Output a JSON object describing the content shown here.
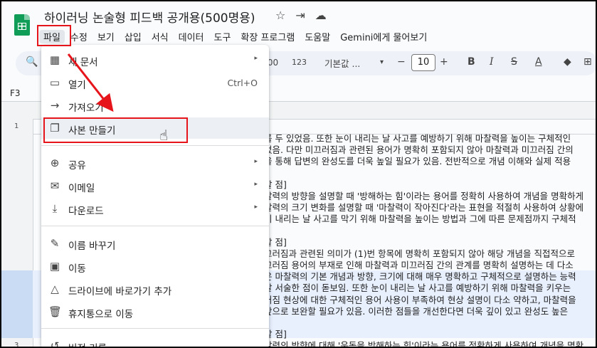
{
  "doc": {
    "title": "하이러닝 논술형 피드백 공개용(500명용)"
  },
  "header_icons": [
    "star-icon",
    "move-folder-icon",
    "cloud-status-icon"
  ],
  "menubar": [
    "파일",
    "수정",
    "보기",
    "삽입",
    "서식",
    "데이터",
    "도구",
    "확장 프로그램",
    "도움말",
    "Gemini에게 물어보기"
  ],
  "toolbar": {
    "number_format": "123",
    "font": "기본값 ...",
    "font_size": "10"
  },
  "name_box": "F3",
  "row_numbers": [
    "1",
    "3"
  ],
  "file_menu": {
    "items": [
      {
        "icon": "new-document-icon",
        "label": "새 문서",
        "arrow": "▸"
      },
      {
        "icon": "open-folder-icon",
        "label": "열기",
        "shortcut": "Ctrl+O"
      },
      {
        "icon": "import-icon",
        "label": "가져오기"
      },
      {
        "icon": "copy-icon",
        "label": "사본 만들기"
      },
      {
        "icon": "share-icon",
        "label": "공유",
        "arrow": "▸"
      },
      {
        "icon": "email-icon",
        "label": "이메일",
        "arrow": "▸"
      },
      {
        "icon": "download-icon",
        "label": "다운로드",
        "arrow": "▸"
      },
      {
        "icon": "rename-icon",
        "label": "이름 바꾸기"
      },
      {
        "icon": "move-icon",
        "label": "이동"
      },
      {
        "icon": "drive-shortcut-icon",
        "label": "드라이브에 바로가기 추가"
      },
      {
        "icon": "trash-icon",
        "label": "휴지통으로 이동"
      },
      {
        "icon": "version-history-icon",
        "label": "버전 기록"
      }
    ]
  },
  "sheet_lines": [
    "를 두 있었음. 또한 눈이 내리는 날 사고를 예방하기 위해 마찰력을 높이는 구체적인",
    "었음. 다만 미끄러짐과 관련된 용어가 명확히 포함되지 않아 마찰력과 미끄러짐 간의",
    "을 통해 답변의 완성도를 더욱 높일 필요가 있음. 전반적으로 개념 이해와 실제 적용",
    "",
    "할 점]",
    "찰력의 방향을 설명할 때 '방해하는 힘'이라는 용어를 정확히 사용하여 개념을 명확하게",
    "찰력의 크기 변화를 설명할 때 '마찰력이 작아진다'라는 표현을 적절히 사용하여 상황에",
    "이 내리는 날 사고를 막기 위해 마찰력을 높이는 방법과 그에 따른 문제점까지 구체적",
    "",
    "할 점]",
    "끄러짐과 관련된 의미가 (1)번 항목에 명확히 포함되지 않아 해당 개념을 직접적으로",
    "끄러짐 용어의 부재로 인해 마찰력과 미끄러짐 간의 관계를 명확히 설명하는 데 다소",
    "은 마찰력의 기본 개념과 방향, 크기에 대해 매우 명확하고 구체적으로 설명하는 능력",
    "잘 서술한 점이 돋보임. 또한 눈이 내리는 날 사고를 예방하기 위해 마찰력을 키우는",
    "러짐 현상에 대한 구체적인 용어 사용이 부족하여 현상 설명이 다소 약하고, 마찰력을",
    "앞으로 보완할 필요가 있음. 이러한 점들을 개선한다면 더욱 깊이 있고 완성도 높은",
    "",
    "할 점]",
    "찰력의 방향에 대해 '운동을 방해하는 힘'이라는 용어를 정확하게 사용하여 개념을 명확"
  ]
}
